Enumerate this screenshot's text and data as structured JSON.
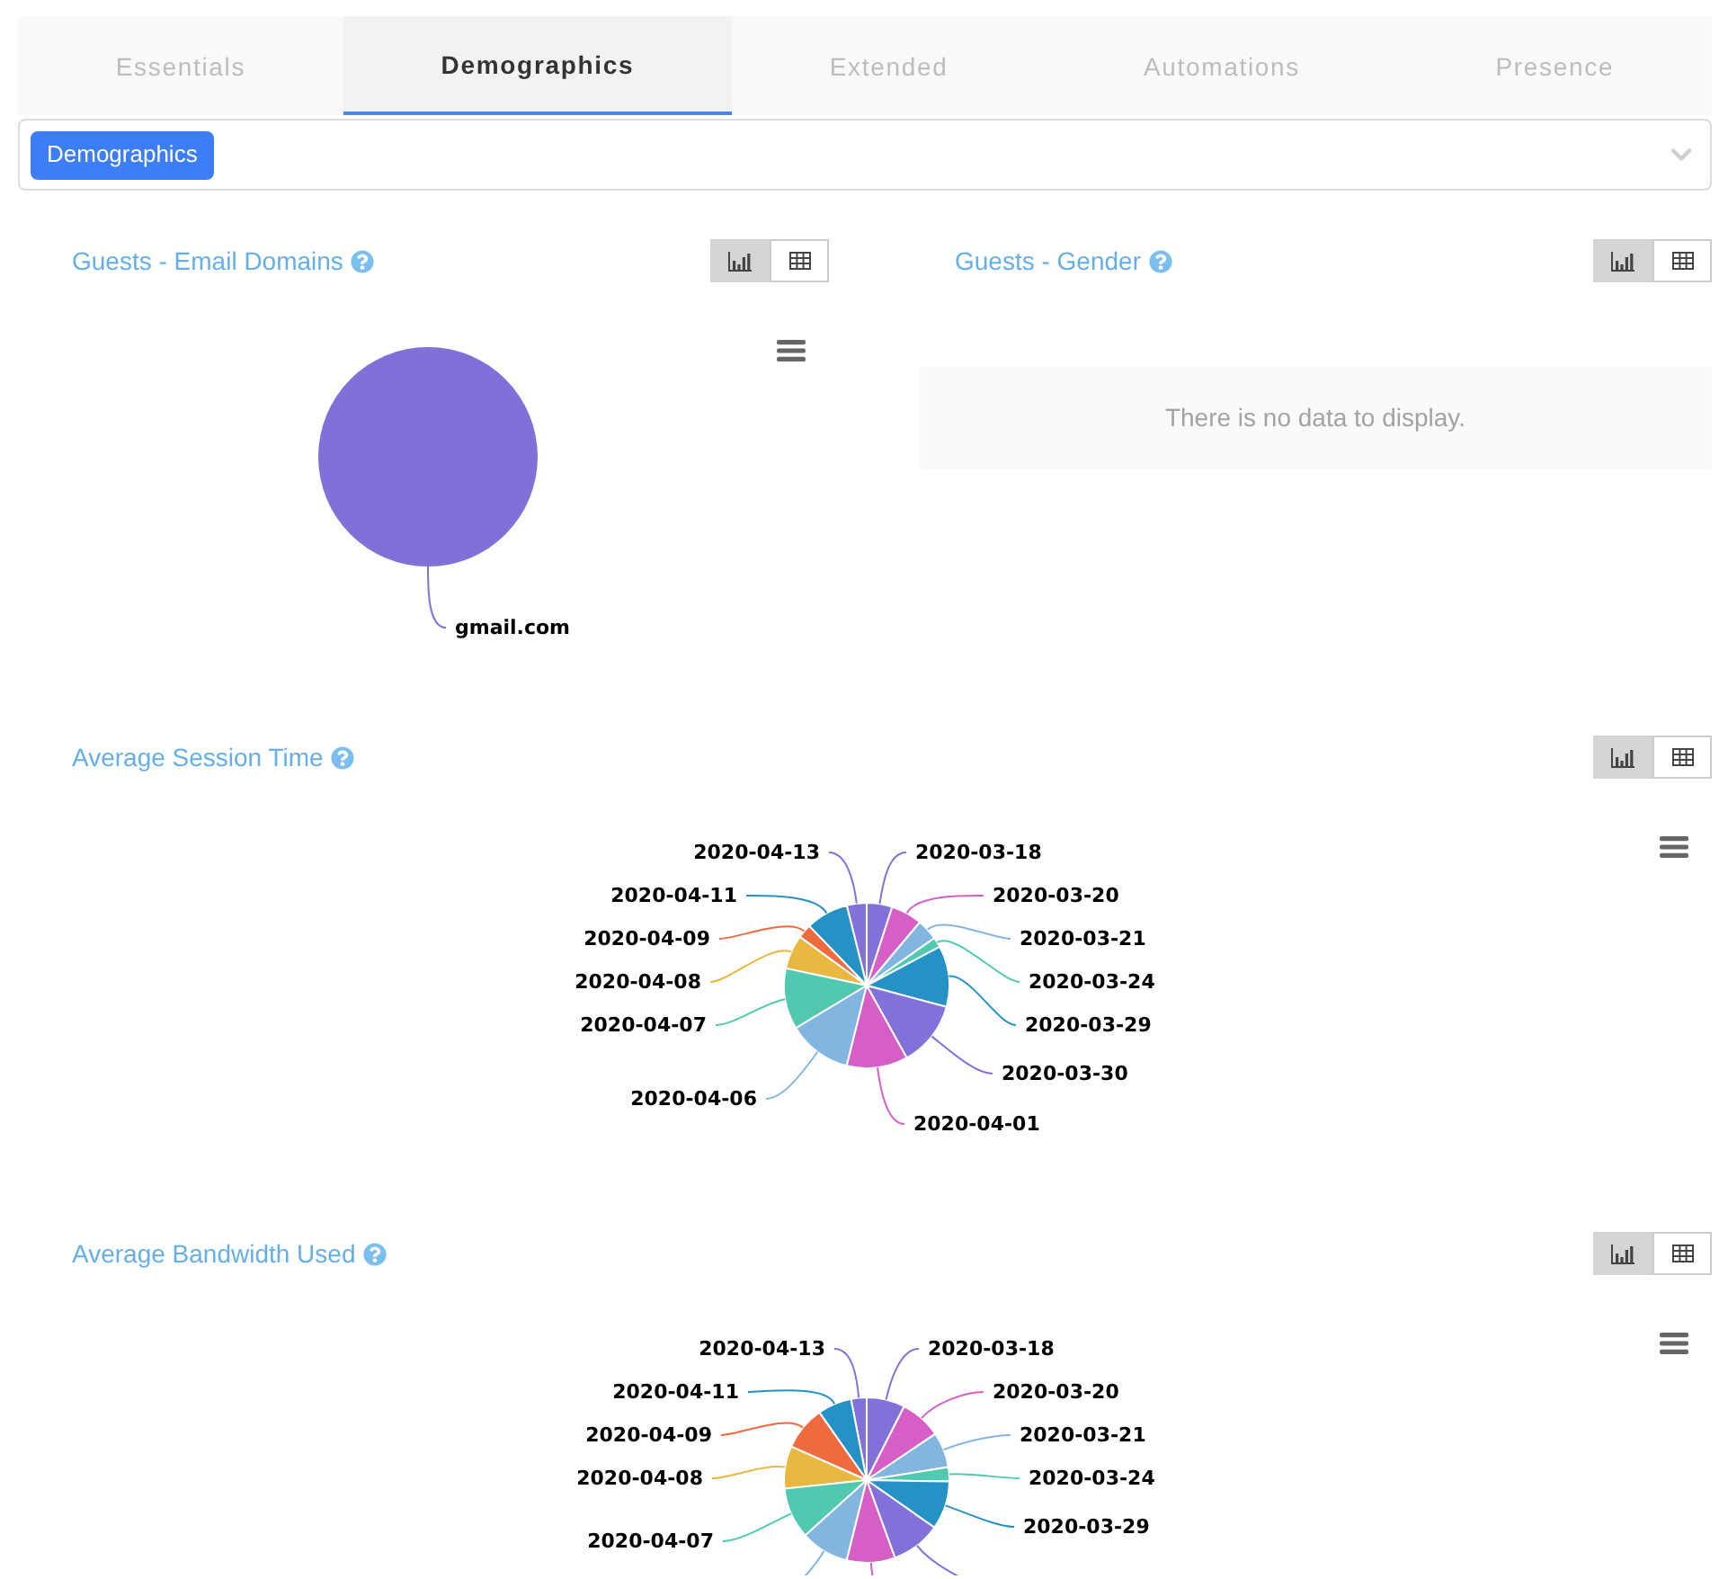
{
  "tabs": [
    {
      "label": "Essentials",
      "selected": false
    },
    {
      "label": "Demographics",
      "selected": true
    },
    {
      "label": "Extended",
      "selected": false
    },
    {
      "label": "Automations",
      "selected": false
    },
    {
      "label": "Presence",
      "selected": false
    }
  ],
  "filter": {
    "chips": [
      "Demographics"
    ]
  },
  "rows": [
    {
      "panels": [
        {
          "title": "Guests - Email Domains",
          "view_toggle": [
            {
              "kind": "chart",
              "selected": true
            },
            {
              "kind": "table",
              "selected": false
            }
          ],
          "chart": {
            "kind": "pie",
            "slices": [
              {
                "label": "gmail.com",
                "color": "#8270d8"
              }
            ]
          }
        },
        {
          "title": "Guests - Gender",
          "view_toggle": [
            {
              "kind": "chart",
              "selected": true
            },
            {
              "kind": "table",
              "selected": false
            }
          ],
          "empty_message": "There is no data to display."
        }
      ]
    },
    {
      "panels": [
        {
          "title": "Average Session Time",
          "view_toggle": [
            {
              "kind": "chart",
              "selected": true
            },
            {
              "kind": "table",
              "selected": false
            }
          ],
          "chart": {
            "kind": "pie",
            "slices": [
              {
                "label": "2020-04-13",
                "color": "#8371d9"
              },
              {
                "label": "2020-03-18",
                "color": "#8371d9"
              },
              {
                "label": "2020-04-11",
                "color": "#2492c4"
              },
              {
                "label": "2020-03-20",
                "color": "#d65fc6"
              },
              {
                "label": "2020-04-09",
                "color": "#ef6a3e"
              },
              {
                "label": "2020-03-21",
                "color": "#82b6e1"
              },
              {
                "label": "2020-04-08",
                "color": "#e9b840"
              },
              {
                "label": "2020-03-24",
                "color": "#50c9b0"
              },
              {
                "label": "2020-04-07",
                "color": "#50c9b0"
              },
              {
                "label": "2020-03-29",
                "color": "#2492c4"
              },
              {
                "label": "2020-03-30",
                "color": "#8371d9"
              },
              {
                "label": "2020-04-06",
                "color": "#82b6e1"
              },
              {
                "label": "2020-04-01",
                "color": "#d65fc6"
              }
            ]
          }
        }
      ]
    },
    {
      "panels": [
        {
          "title": "Average Bandwidth Used",
          "view_toggle": [
            {
              "kind": "chart",
              "selected": true
            },
            {
              "kind": "table",
              "selected": false
            }
          ],
          "chart": {
            "kind": "pie",
            "slices": [
              {
                "label": "2020-04-13",
                "color": "#8371d9"
              },
              {
                "label": "2020-03-18",
                "color": "#8371d9"
              },
              {
                "label": "2020-04-11",
                "color": "#2492c4"
              },
              {
                "label": "2020-03-20",
                "color": "#d65fc6"
              },
              {
                "label": "2020-04-09",
                "color": "#ef6a3e"
              },
              {
                "label": "2020-03-21",
                "color": "#82b6e1"
              },
              {
                "label": "2020-04-08",
                "color": "#e9b840"
              },
              {
                "label": "2020-03-24",
                "color": "#50c9b0"
              },
              {
                "label": "2020-03-29",
                "color": "#2492c4"
              },
              {
                "label": "2020-04-07",
                "color": "#50c9b0"
              },
              {
                "color": "#8371d9"
              },
              {
                "color": "#82b6e1"
              },
              {
                "color": "#d65fc6"
              }
            ]
          }
        }
      ]
    }
  ]
}
